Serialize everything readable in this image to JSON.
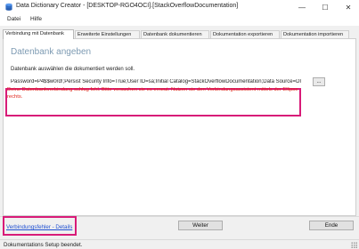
{
  "window": {
    "title": "Data Dictionary Creator - [DESKTOP-RGO4OCI].[StackOverflowDocumentation]",
    "minimize_glyph": "—",
    "maximize_glyph": "☐",
    "close_glyph": "✕",
    "icon": "app-logo-icon"
  },
  "menu": {
    "items": [
      {
        "label": "Datei"
      },
      {
        "label": "Hilfe"
      }
    ]
  },
  "tabs": [
    {
      "label": "Verbindung mit Datenbank",
      "active": true
    },
    {
      "label": "Erweiterte Einstellungen",
      "active": false
    },
    {
      "label": "Datenbank dokumentieren",
      "active": false
    },
    {
      "label": "Dokumentation exportieren",
      "active": false
    },
    {
      "label": "Dokumentation importieren",
      "active": false
    }
  ],
  "panel": {
    "heading": "Datenbank angeben",
    "select_label": "Datenbank auswählen die dokumentiert werden soll.",
    "connection_string": "Password=P4$$w0rd!;Persist Security Info=True;User ID=sa;Initial Catalog=StackOverflowDocumentation;Data Source=DI",
    "browse_label": "...",
    "error_message": "Deine Datenbankverbindung schlug fehl. Bitte versuchen sie es erneut. Nutzen sie den Verbindungsassistent mittels der Ellipse rechts."
  },
  "footer": {
    "details_link": "Verbindungsfehler - Details",
    "next_label": "Weiter",
    "end_label": "Ende"
  },
  "status": {
    "text": "Dokumentations Setup beendet."
  },
  "colors": {
    "accent_highlight": "#d81b78",
    "error_text": "#e0241b",
    "heading_text": "#7e9bb3",
    "link": "#1f4fd1"
  }
}
